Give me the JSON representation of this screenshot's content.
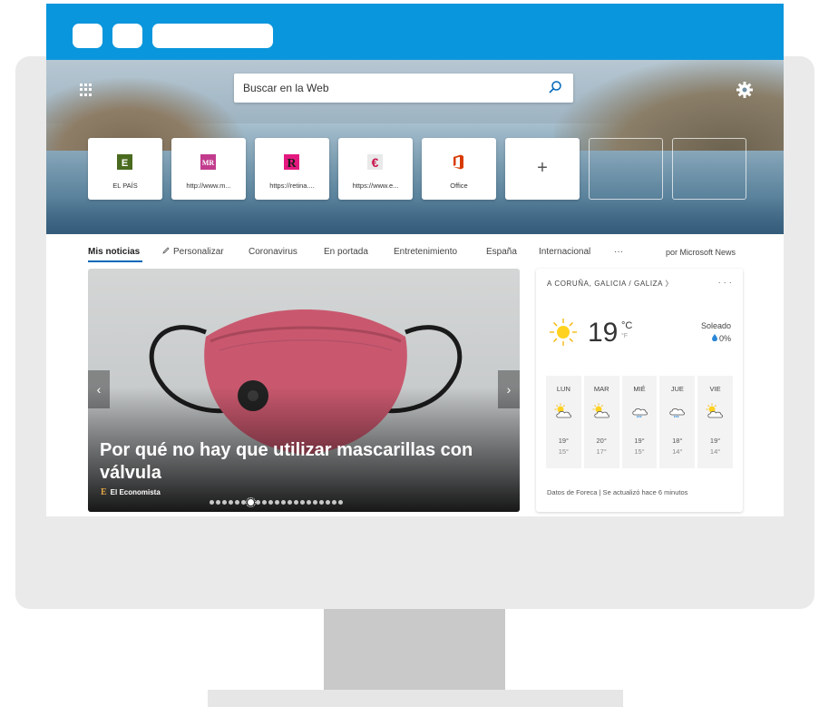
{
  "search": {
    "placeholder": "Buscar en la Web"
  },
  "tiles": [
    {
      "label": "EL PAÍS",
      "icon": "el-pais-logo",
      "color": "#4a6b1f",
      "letter": "E"
    },
    {
      "label": "http://www.m...",
      "icon": "mr-logo",
      "color": "#b43c8c",
      "letter": "MR"
    },
    {
      "label": "https://retina....",
      "icon": "retina-logo",
      "color": "#e4197f",
      "letter": "R"
    },
    {
      "label": "https://www.e...",
      "icon": "expansion-logo",
      "color": "#c8124a",
      "letter": "€"
    },
    {
      "label": "Office",
      "icon": "office-logo",
      "color": "#d83b01"
    },
    {
      "label": "+",
      "icon": "add-icon"
    }
  ],
  "nav": {
    "items": [
      "Mis noticias",
      "Personalizar",
      "Coronavirus",
      "En portada",
      "Entretenimiento",
      "España",
      "Internacional",
      "···"
    ],
    "by": "por Microsoft News"
  },
  "news": {
    "headline": "Por qué no hay que utilizar mascarillas con válvula",
    "source_logo": "E",
    "source": "El Economista",
    "prev": "‹",
    "next": "›",
    "dots_total": 21,
    "dots_active": 6
  },
  "weather": {
    "location": "A CORUÑA, GALICIA / GALIZA  〉",
    "more": "· · ·",
    "temp": "19",
    "unit": "°C",
    "unit_alt": "°F",
    "condition": "Soleado",
    "precip": "0%",
    "forecast": [
      {
        "day": "LUN",
        "hi": "19°",
        "lo": "15°",
        "icon": "partly-sunny-icon"
      },
      {
        "day": "MAR",
        "hi": "20°",
        "lo": "17°",
        "icon": "partly-sunny-icon"
      },
      {
        "day": "MIÉ",
        "hi": "19°",
        "lo": "15°",
        "icon": "rain-cloud-icon"
      },
      {
        "day": "JUE",
        "hi": "18°",
        "lo": "14°",
        "icon": "rain-cloud-icon"
      },
      {
        "day": "VIE",
        "hi": "19°",
        "lo": "14°",
        "icon": "partly-sunny-icon"
      }
    ],
    "footer": "Datos de Foreca | Se actualizó hace 6 minutos"
  },
  "colors": {
    "browser_bar": "#0a96dc",
    "accent": "#0067b8"
  }
}
